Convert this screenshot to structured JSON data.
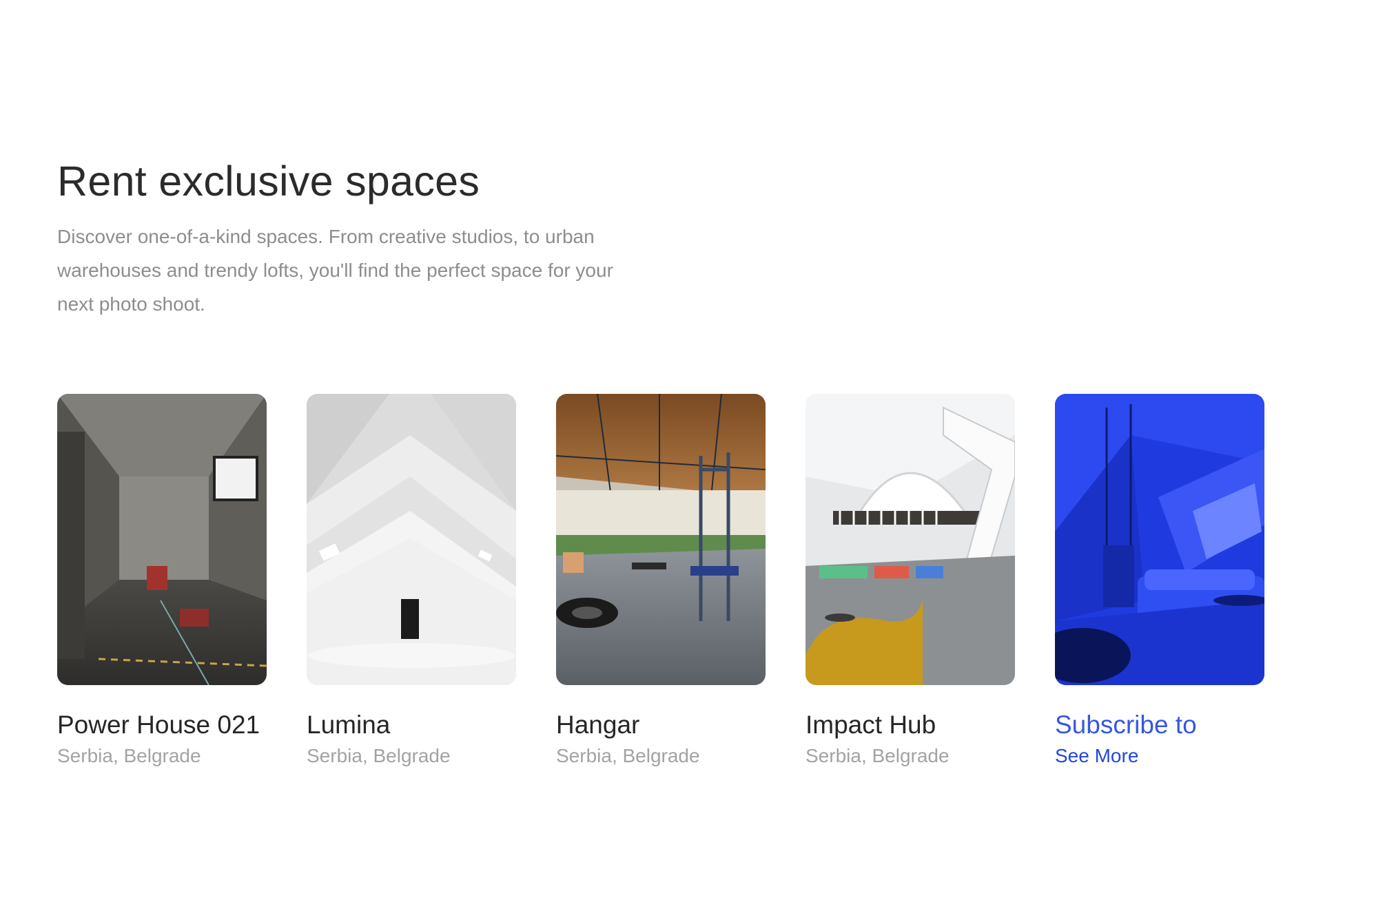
{
  "section": {
    "title": "Rent exclusive spaces",
    "description": "Discover one-of-a-kind spaces. From creative studios, to urban warehouses and trendy lofts, you'll find the perfect space for your next photo shoot."
  },
  "spaces": [
    {
      "name": "Power House 021",
      "location": "Serbia, Belgrade",
      "image": "concrete-basement-photo"
    },
    {
      "name": "Lumina",
      "location": "Serbia, Belgrade",
      "image": "white-attic-studio-photo"
    },
    {
      "name": "Hangar",
      "location": "Serbia, Belgrade",
      "image": "industrial-gym-photo"
    },
    {
      "name": "Impact Hub",
      "location": "Serbia, Belgrade",
      "image": "coworking-hall-photo"
    }
  ],
  "subscribe": {
    "title": "Subscribe to",
    "link": "See More",
    "image": "blue-attic-lounge-photo",
    "tint": "#1f3be0"
  }
}
